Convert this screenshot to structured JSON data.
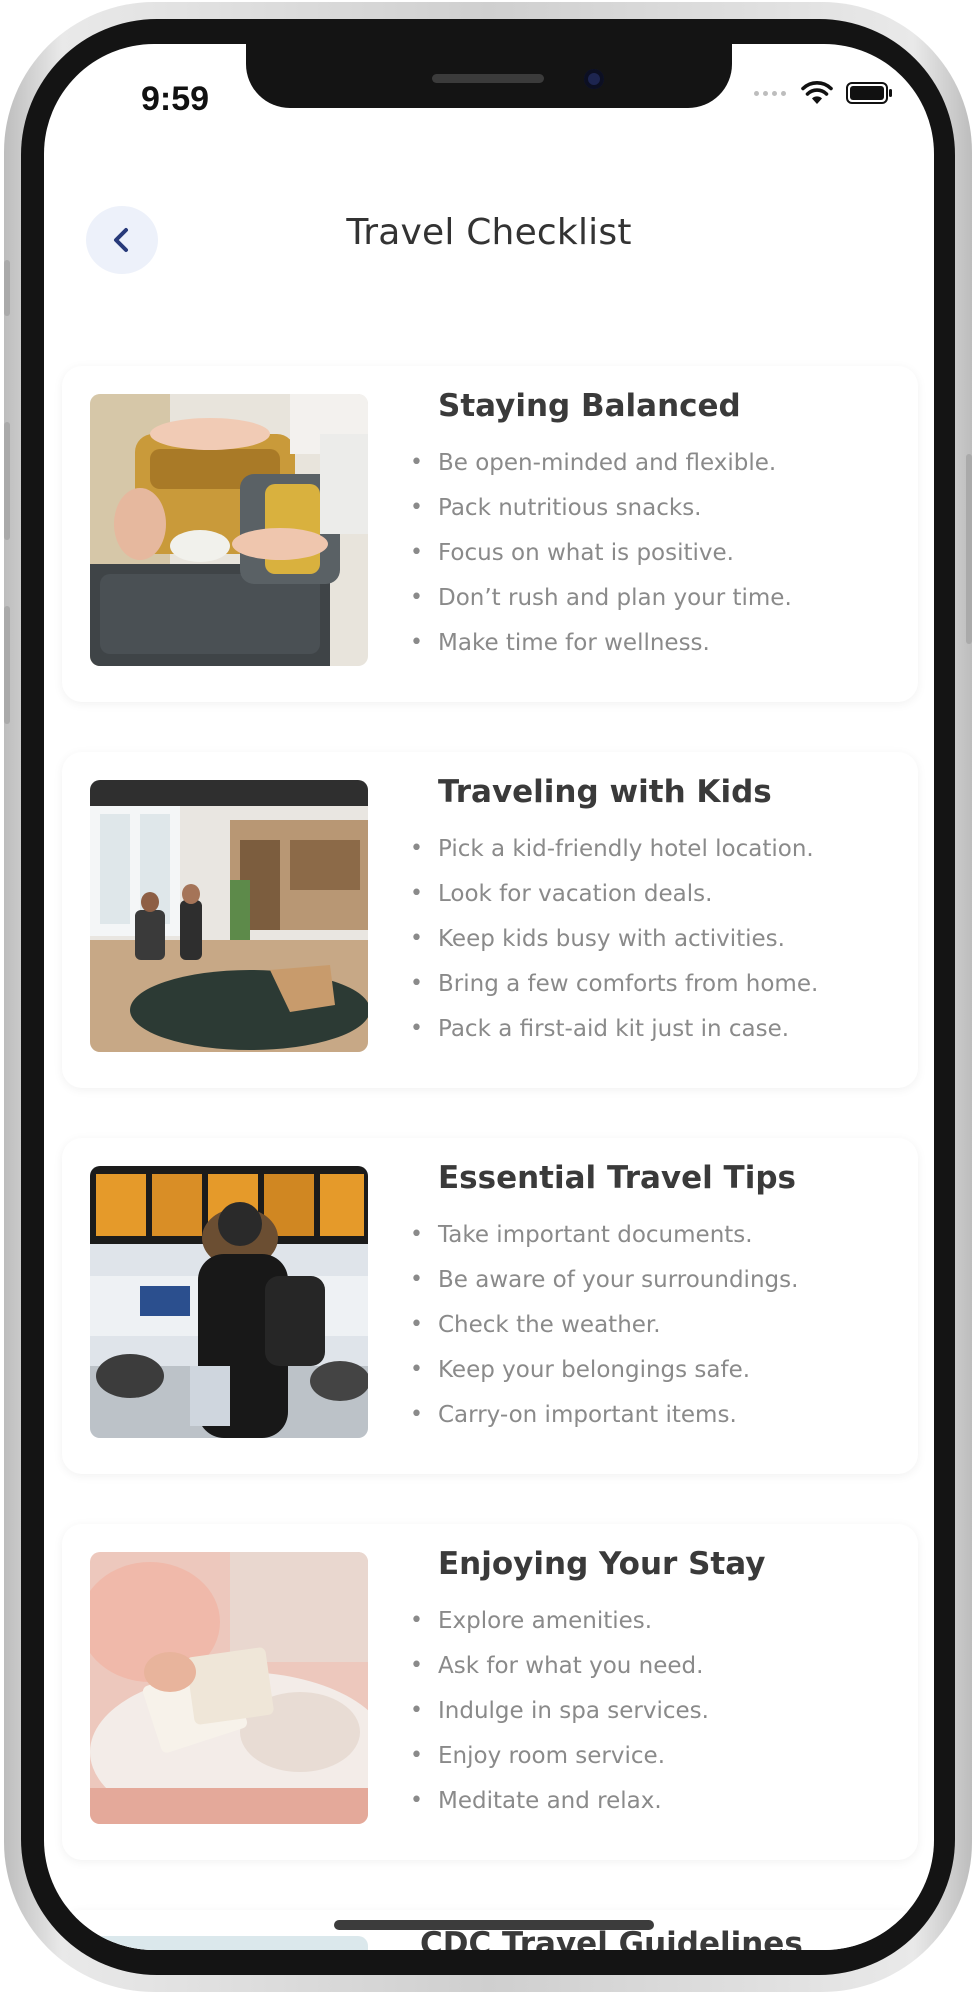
{
  "status_bar": {
    "time": "9:59"
  },
  "header": {
    "title": "Travel Checklist"
  },
  "icons": {
    "back": "chevron-left-icon",
    "wifi": "wifi-icon",
    "battery": "battery-icon"
  },
  "colors": {
    "title_text": "#333333",
    "item_text": "#8a8a8a",
    "back_button_bg": "#edf1fa",
    "back_chevron": "#283a7a"
  },
  "cards": [
    {
      "title": "Staying Balanced",
      "image": "packing-suitcase-photo",
      "items": [
        "Be open-minded and flexible.",
        "Pack nutritious snacks.",
        "Focus on what is positive.",
        "Don’t rush and plan your time.",
        "Make time for wellness."
      ]
    },
    {
      "title": "Traveling with Kids",
      "image": "hotel-lobby-photo",
      "items": [
        "Pick a kid-friendly hotel location.",
        "Look for vacation deals.",
        "Keep kids busy with activities.",
        "Bring a few comforts from home.",
        "Pack a first-aid kit just in case."
      ]
    },
    {
      "title": "Essential Travel Tips",
      "image": "airport-departures-photo",
      "items": [
        "Take important documents.",
        "Be aware of your surroundings.",
        "Check the weather.",
        "Keep your belongings safe.",
        "Carry-on important items."
      ]
    },
    {
      "title": "Enjoying Your Stay",
      "image": "reading-in-bed-photo",
      "items": [
        "Explore amenities.",
        "Ask for what you need.",
        "Indulge in spa services.",
        "Enjoy room service.",
        "Meditate and relax."
      ]
    }
  ],
  "next_card": {
    "title": "CDC Travel Guidelines"
  }
}
